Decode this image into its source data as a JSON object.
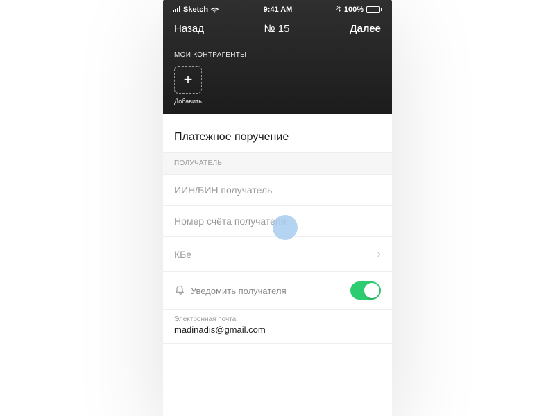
{
  "status": {
    "carrier": "Sketch",
    "time": "9:41 AM",
    "battery": "100%"
  },
  "nav": {
    "back": "Назад",
    "title": "№ 15",
    "next": "Далее"
  },
  "header": {
    "section_label": "МОИ КОНТРАГЕНТЫ",
    "add_label": "Добавить"
  },
  "form": {
    "title": "Платежное поручение",
    "recipient_group": "ПОЛУЧАТЕЛЬ",
    "fields": {
      "iin_bin": "ИИН/БИН получатель",
      "account": "Номер счёта получателя",
      "kbe": "КБе",
      "notify": "Уведомить получателя"
    },
    "notify_on": true,
    "email_label": "Электронная почта",
    "email_value": "madinadis@gmail.com"
  }
}
